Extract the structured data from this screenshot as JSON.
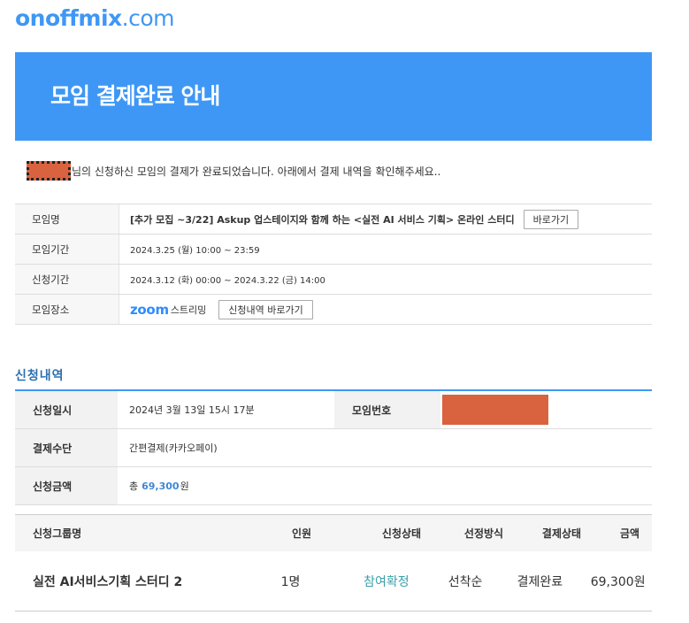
{
  "logo": {
    "main": "onoffmix",
    "suffix": ".com"
  },
  "banner": {
    "title": "모임 결제완료 안내"
  },
  "intro": {
    "text": "님의 신청하신 모임의 결제가 완료되었습니다. 아래에서 결제 내역을 확인해주세요.."
  },
  "info": {
    "name_label": "모임명",
    "name_value": "[추가 모집 ~3/22] Askup 업스테이지와 함께 하는 <실전 AI 서비스 기획> 온라인 스터디",
    "go_button": "바로가기",
    "period_label": "모임기간",
    "period_value": "2024.3.25 (월) 10:00 ~ 23:59",
    "apply_period_label": "신청기간",
    "apply_period_value": "2024.3.12 (화) 00:00 ~ 2024.3.22 (금) 14:00",
    "place_label": "모임장소",
    "zoom_logo": "zoom",
    "streaming": "스트리밍",
    "history_button": "신청내역 바로가기"
  },
  "section": {
    "title": "신청내역"
  },
  "apply": {
    "date_label": "신청일시",
    "date_value": "2024년 3월 13일 15시 17분",
    "number_label": "모임번호",
    "method_label": "결제수단",
    "method_value": "간편결제(카카오페이)",
    "amount_label": "신청금액",
    "amount_prefix": "총",
    "amount_value": "69,300",
    "amount_unit": "원"
  },
  "group": {
    "headers": [
      "신청그룹명",
      "인원",
      "신청상태",
      "선정방식",
      "결제상태",
      "금액"
    ],
    "row": {
      "name": "실전 AI서비스기획 스터디 2",
      "count": "1명",
      "status": "참여확정",
      "selection": "선착순",
      "payment": "결제완료",
      "price": "69,300원"
    }
  },
  "colors": {
    "brand": "#3f97f5",
    "redaction": "#d9623f",
    "confirmed": "#3aa0a9"
  }
}
